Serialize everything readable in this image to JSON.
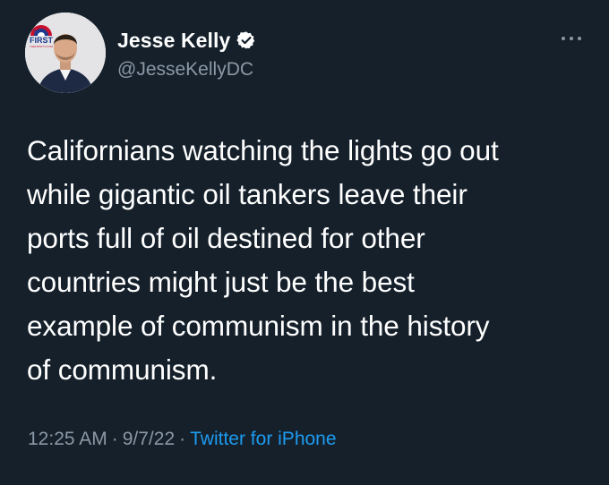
{
  "author": {
    "display_name": "Jesse Kelly",
    "handle": "@JesseKellyDC",
    "verified": true,
    "avatar_badge_line1": "THE",
    "avatar_badge_line2": "FIRST",
    "avatar_badge_url": "THEFIRSTTV.COM"
  },
  "tweet": {
    "text": "Californians watching the lights go out\nwhile gigantic oil tankers leave their\nports full of oil destined for other\ncountries might just be the best\nexample of communism in the history\nof communism.",
    "time": "12:25 AM",
    "date": "9/7/22",
    "separator": "·",
    "source": "Twitter for iPhone"
  },
  "icons": {
    "verified": "verified-badge-icon",
    "more": "more-options-icon"
  },
  "colors": {
    "background": "#15202b",
    "text_primary": "#ffffff",
    "text_secondary": "#8b98a5",
    "link": "#1d9bf0",
    "verified": "#ffffff"
  }
}
